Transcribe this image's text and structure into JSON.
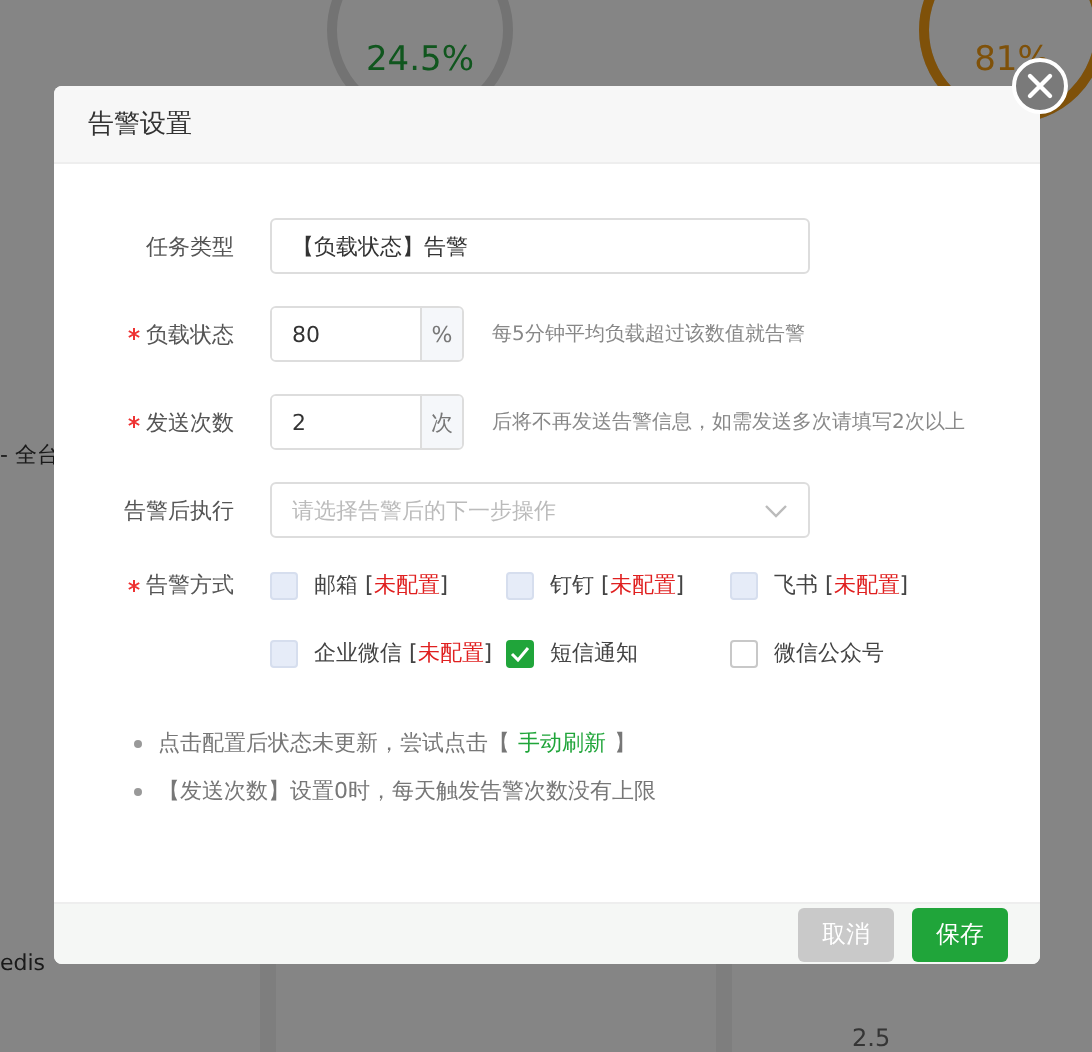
{
  "background": {
    "gauges": [
      {
        "value": "24.5%",
        "kind": "normal"
      },
      {
        "value": "81%",
        "kind": "warning"
      }
    ],
    "side_text": "- 全台",
    "app_name": "edis",
    "axis_tick": "2.5"
  },
  "dialog": {
    "title": "告警设置",
    "fields": [
      {
        "kind": "text",
        "label": "任务类型",
        "required": false,
        "value": "【负载状态】告警"
      },
      {
        "kind": "number",
        "label": "负载状态",
        "required": true,
        "value": "80",
        "unit": "%",
        "hint": "每5分钟平均负载超过该数值就告警"
      },
      {
        "kind": "number",
        "label": "发送次数",
        "required": true,
        "value": "2",
        "unit": "次",
        "hint": "后将不再发送告警信息，如需发送多次请填写2次以上"
      },
      {
        "kind": "select",
        "label": "告警后执行",
        "required": false,
        "placeholder": "请选择告警后的下一步操作"
      }
    ],
    "methods_label": "告警方式",
    "methods_required": true,
    "methods": [
      {
        "label": "邮箱",
        "status": {
          "open": "[",
          "text": "未配置",
          "close": "]"
        },
        "checked": false,
        "disabled": true
      },
      {
        "label": "钉钉",
        "status": {
          "open": "[",
          "text": "未配置",
          "close": "]"
        },
        "checked": false,
        "disabled": true
      },
      {
        "label": "飞书",
        "status": {
          "open": "[",
          "text": "未配置",
          "close": "]"
        },
        "checked": false,
        "disabled": true
      },
      {
        "label": "企业微信",
        "status": {
          "open": "[",
          "text": "未配置",
          "close": "]"
        },
        "checked": false,
        "disabled": true
      },
      {
        "label": "短信通知",
        "checked": true,
        "disabled": false
      },
      {
        "label": "微信公众号",
        "checked": false,
        "disabled": false
      }
    ],
    "notes": [
      {
        "text": "点击配置后状态未更新，尝试点击【",
        "link": "手动刷新",
        "after": "】"
      },
      {
        "text": "【发送次数】设置0时，每天触发告警次数没有上限"
      }
    ],
    "buttons": [
      {
        "kind": "cancel",
        "label": "取消"
      },
      {
        "kind": "primary",
        "label": "保存"
      }
    ]
  }
}
